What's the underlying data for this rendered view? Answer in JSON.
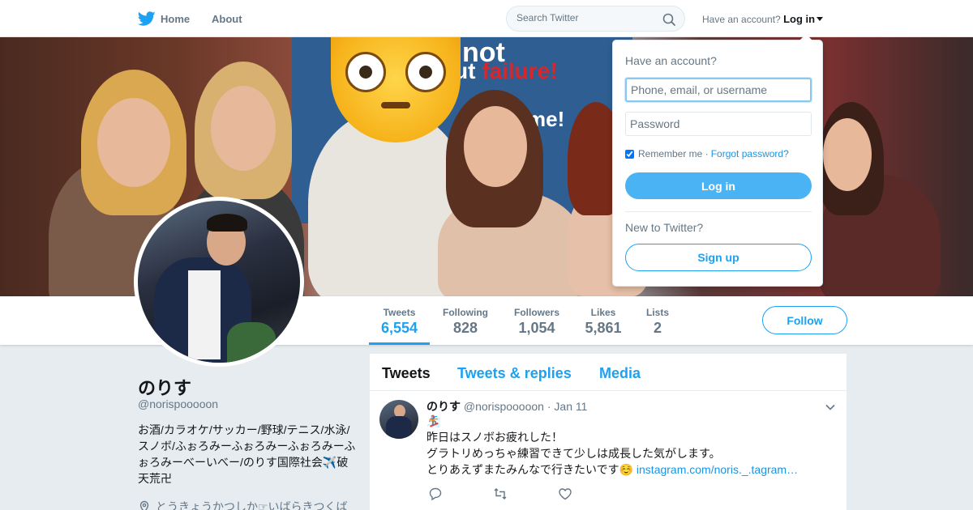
{
  "topbar": {
    "home_label": "Home",
    "about_label": "About",
    "search_placeholder": "Search Twitter",
    "account_prompt": "Have an account?",
    "login_label": "Log in"
  },
  "header_photo": {
    "sign_line1": "not",
    "sign_line2_prefix": "ut ",
    "sign_line2_word": "failure!",
    "sign_line3": "me!"
  },
  "profile_nav": {
    "stats": [
      {
        "label": "Tweets",
        "value": "6,554",
        "active": true
      },
      {
        "label": "Following",
        "value": "828",
        "active": false
      },
      {
        "label": "Followers",
        "value": "1,054",
        "active": false
      },
      {
        "label": "Likes",
        "value": "5,861",
        "active": false
      },
      {
        "label": "Lists",
        "value": "2",
        "active": false
      }
    ],
    "follow_label": "Follow"
  },
  "profile": {
    "display_name": "のりす",
    "handle": "@norispooooon",
    "bio": "お酒/カラオケ/サッカー/野球/テニス/水泳/スノボ/ふぉろみーふぉろみーふぉろみーふぉろみーべーいべー/のりす国際社会✈️破天荒卍",
    "location": "とうきょうかつしか☞いばらきつくば"
  },
  "timeline": {
    "tabs": [
      "Tweets",
      "Tweets & replies",
      "Media"
    ],
    "tweet": {
      "author_name": "のりす",
      "author_handle": "@norispooooon",
      "separator": "·",
      "date": "Jan 11",
      "emoji_line": "🏂",
      "line1": "昨日はスノボお疲れした！",
      "line2": "グラトリめっちゃ練習できて少しは成長した気がします。",
      "line3": "とりあえずまたみんなで行きたいです☺️",
      "link": "instagram.com/noris._.tagram…"
    }
  },
  "login_dropdown": {
    "title": "Have an account?",
    "username_placeholder": "Phone, email, or username",
    "password_placeholder": "Password",
    "remember_label": "Remember me",
    "dot": "·",
    "forgot_label": "Forgot password?",
    "login_button": "Log in",
    "new_prompt": "New to Twitter?",
    "signup_button": "Sign up"
  },
  "colors": {
    "brand": "#1da1f2",
    "text_primary": "#14171a",
    "text_secondary": "#657786",
    "page_bg": "#e6ecf0"
  }
}
